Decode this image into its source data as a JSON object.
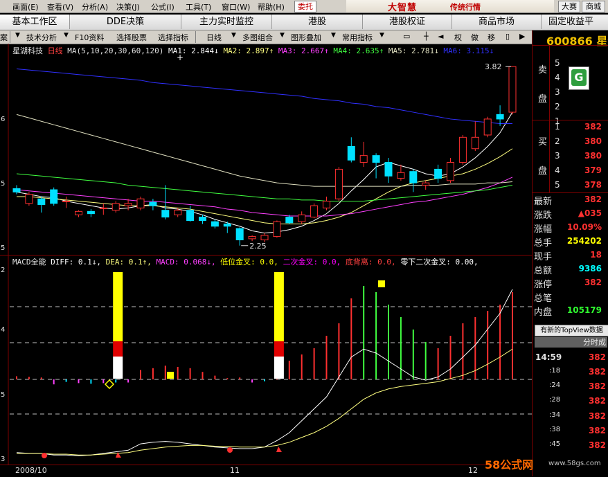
{
  "menu": {
    "items": [
      "画面(E)",
      "查看(V)",
      "分析(A)",
      "决策(J)",
      "公式(I)",
      "工具(T)",
      "窗口(W)",
      "帮助(H)"
    ],
    "weituo": "委托",
    "brand_logo": "大智慧",
    "brand_sub": "传统行情",
    "right_btn1": "大赛",
    "right_btn2": "商城"
  },
  "tabs": [
    "基本工作区",
    "DDE决策",
    "主力实时监控",
    "港股",
    "港股权证",
    "商品市场",
    "固定收益平"
  ],
  "toolbar": {
    "items": [
      "案",
      "技术分析",
      "F10资料",
      "选择股票",
      "选择指标",
      "日线",
      "多图组合",
      "图形叠加",
      "常用指标"
    ],
    "right": [
      "权",
      "做",
      "移"
    ]
  },
  "stock": {
    "code": "600866",
    "name_partial": "星湖",
    "title": "星湖科技",
    "period": "日线"
  },
  "ma_legend": {
    "param": "MA(5,10,20,30,60,120)",
    "ma1": "MA1: 2.844↓",
    "ma2": "MA2: 2.897↑",
    "ma3": "MA3: 2.667↑",
    "ma4": "MA4: 2.635↑",
    "ma5": "MA5: 2.781↓",
    "ma6": "MA6: 3.115↓"
  },
  "macd_legend": {
    "name": "MACD全能",
    "diff": "DIFF: 0.1↓,",
    "dea": "DEA: 0.1↑,",
    "macd": "MACD: 0.068↓,",
    "low_cross": "低位金叉: 0.0,",
    "second_cross": "二次金叉: 0.0,",
    "divergence": "底背离: 0.0,",
    "zero_cross": "零下二次金叉: 0.00,"
  },
  "chart_labels": {
    "high_label": "3.82",
    "low_label": "2.25",
    "left_axis_main": [
      "",
      "6",
      "5",
      "5"
    ],
    "left_axis_macd": [
      "2",
      "4",
      "5",
      "3"
    ],
    "x_labels": [
      "2008/10",
      "11",
      "12"
    ]
  },
  "order_book": {
    "sell_label_1": "卖",
    "sell_label_2": "盘",
    "sell_levels": [
      "5",
      "4",
      "3",
      "2",
      "1"
    ],
    "buy_label_1": "买",
    "buy_label_2": "盘",
    "buy_levels": [
      "1",
      "2",
      "3",
      "4",
      "5"
    ],
    "buy_prices": [
      "382",
      "380",
      "380",
      "379",
      "378"
    ]
  },
  "quote": {
    "rows": [
      {
        "label": "最新",
        "value": "382"
      },
      {
        "label": "涨跌",
        "value": "▲035"
      },
      {
        "label": "涨幅",
        "value": "10.09%"
      },
      {
        "label": "总手",
        "value": "254202"
      },
      {
        "label": "现手",
        "value": "18"
      },
      {
        "label": "总额",
        "value": "9386"
      },
      {
        "label": "涨停",
        "value": "382"
      },
      {
        "label": "总笔",
        "value": ""
      },
      {
        "label": "内盘",
        "value": "105179"
      }
    ]
  },
  "topview": "有新的TopView数据",
  "fenshi": "分时成",
  "ticks": [
    {
      "time": "14:59",
      "price": "382"
    },
    {
      "time": ":18",
      "price": "382"
    },
    {
      "time": ":24",
      "price": "382"
    },
    {
      "time": ":28",
      "price": "382"
    },
    {
      "time": ":34",
      "price": "382"
    },
    {
      "time": ":38",
      "price": "382"
    },
    {
      "time": ":45",
      "price": "382"
    }
  ],
  "watermark": "58公式网",
  "watermark_url": "www.58gs.com",
  "chart_data": {
    "type": "candlestick",
    "title": "星湖科技 日线",
    "candles": [
      {
        "o": 2.75,
        "c": 2.72,
        "h": 2.78,
        "l": 2.7
      },
      {
        "o": 2.62,
        "c": 2.7,
        "h": 2.72,
        "l": 2.6
      },
      {
        "o": 2.66,
        "c": 2.61,
        "h": 2.68,
        "l": 2.54
      },
      {
        "o": 2.74,
        "c": 2.62,
        "h": 2.76,
        "l": 2.6
      },
      {
        "o": 2.64,
        "c": 2.64,
        "h": 2.68,
        "l": 2.58
      },
      {
        "o": 2.52,
        "c": 2.55,
        "h": 2.56,
        "l": 2.5
      },
      {
        "o": 2.55,
        "c": 2.53,
        "h": 2.57,
        "l": 2.5
      },
      {
        "o": 2.58,
        "c": 2.58,
        "h": 2.62,
        "l": 2.52
      },
      {
        "o": 2.56,
        "c": 2.62,
        "h": 2.64,
        "l": 2.54
      },
      {
        "o": 2.6,
        "c": 2.62,
        "h": 2.66,
        "l": 2.56
      },
      {
        "o": 2.58,
        "c": 2.66,
        "h": 2.68,
        "l": 2.56
      },
      {
        "o": 2.63,
        "c": 2.6,
        "h": 2.66,
        "l": 2.56
      },
      {
        "o": 2.56,
        "c": 2.5,
        "h": 2.78,
        "l": 2.48
      },
      {
        "o": 2.52,
        "c": 2.56,
        "h": 2.58,
        "l": 2.5
      },
      {
        "o": 2.56,
        "c": 2.47,
        "h": 2.6,
        "l": 2.46
      },
      {
        "o": 2.5,
        "c": 2.47,
        "h": 2.52,
        "l": 2.44
      },
      {
        "o": 2.46,
        "c": 2.42,
        "h": 2.48,
        "l": 2.4
      },
      {
        "o": 2.44,
        "c": 2.42,
        "h": 2.46,
        "l": 2.36
      },
      {
        "o": 2.4,
        "c": 2.3,
        "h": 2.41,
        "l": 2.25
      },
      {
        "o": 2.31,
        "c": 2.33,
        "h": 2.34,
        "l": 2.29
      },
      {
        "o": 2.3,
        "c": 2.34,
        "h": 2.36,
        "l": 2.28
      },
      {
        "o": 2.33,
        "c": 2.46,
        "h": 2.47,
        "l": 2.32
      },
      {
        "o": 2.5,
        "c": 2.45,
        "h": 2.52,
        "l": 2.44
      },
      {
        "o": 2.46,
        "c": 2.52,
        "h": 2.55,
        "l": 2.44
      },
      {
        "o": 2.5,
        "c": 2.6,
        "h": 2.62,
        "l": 2.49
      },
      {
        "o": 2.58,
        "c": 2.64,
        "h": 2.68,
        "l": 2.56
      },
      {
        "o": 2.66,
        "c": 2.92,
        "h": 2.94,
        "l": 2.64
      },
      {
        "o": 3.12,
        "c": 3.0,
        "h": 3.2,
        "l": 2.98
      },
      {
        "o": 2.98,
        "c": 3.04,
        "h": 3.16,
        "l": 2.94
      },
      {
        "o": 3.04,
        "c": 2.98,
        "h": 3.06,
        "l": 2.84
      },
      {
        "o": 2.98,
        "c": 2.86,
        "h": 3.02,
        "l": 2.8
      },
      {
        "o": 2.84,
        "c": 2.89,
        "h": 2.96,
        "l": 2.82
      },
      {
        "o": 2.9,
        "c": 2.8,
        "h": 2.92,
        "l": 2.72
      },
      {
        "o": 2.78,
        "c": 2.8,
        "h": 2.82,
        "l": 2.74
      },
      {
        "o": 2.92,
        "c": 2.84,
        "h": 2.96,
        "l": 2.8
      },
      {
        "o": 2.82,
        "c": 2.98,
        "h": 3.02,
        "l": 2.8
      },
      {
        "o": 2.98,
        "c": 3.2,
        "h": 3.22,
        "l": 2.96
      },
      {
        "o": 3.1,
        "c": 3.2,
        "h": 3.34,
        "l": 3.08
      },
      {
        "o": 3.22,
        "c": 3.36,
        "h": 3.38,
        "l": 3.2
      },
      {
        "o": 3.4,
        "c": 3.36,
        "h": 3.48,
        "l": 3.3
      },
      {
        "o": 3.42,
        "c": 3.82,
        "h": 3.82,
        "l": 3.4
      }
    ],
    "ylim": [
      2.2,
      3.9
    ],
    "ma": [
      {
        "name": "MA1",
        "color": "#ffffff",
        "values": [
          2.72,
          2.7,
          2.68,
          2.67,
          2.64,
          2.62,
          2.6,
          2.58,
          2.57,
          2.58,
          2.6,
          2.61,
          2.58,
          2.57,
          2.55,
          2.52,
          2.48,
          2.45,
          2.42,
          2.38,
          2.36,
          2.37,
          2.39,
          2.42,
          2.47,
          2.53,
          2.62,
          2.73,
          2.83,
          2.94,
          2.98,
          2.95,
          2.92,
          2.88,
          2.86,
          2.88,
          2.94,
          3.02,
          3.12,
          3.24,
          3.42
        ]
      },
      {
        "name": "MA2",
        "color": "#ffff80",
        "values": [
          2.68,
          2.68,
          2.67,
          2.66,
          2.65,
          2.64,
          2.63,
          2.62,
          2.61,
          2.6,
          2.6,
          2.6,
          2.59,
          2.58,
          2.57,
          2.55,
          2.53,
          2.51,
          2.49,
          2.47,
          2.45,
          2.44,
          2.44,
          2.44,
          2.45,
          2.47,
          2.5,
          2.54,
          2.6,
          2.66,
          2.72,
          2.77,
          2.8,
          2.82,
          2.84,
          2.86,
          2.88,
          2.92,
          2.97,
          3.03,
          3.1
        ]
      },
      {
        "name": "MA3",
        "color": "#ff40ff",
        "values": [
          2.74,
          2.73,
          2.72,
          2.71,
          2.7,
          2.69,
          2.68,
          2.67,
          2.66,
          2.65,
          2.64,
          2.64,
          2.63,
          2.62,
          2.61,
          2.6,
          2.59,
          2.57,
          2.56,
          2.54,
          2.53,
          2.52,
          2.51,
          2.51,
          2.51,
          2.51,
          2.52,
          2.53,
          2.55,
          2.57,
          2.59,
          2.61,
          2.63,
          2.64,
          2.66,
          2.68,
          2.7,
          2.73,
          2.76,
          2.8,
          2.85
        ]
      },
      {
        "name": "MA4",
        "color": "#40ff40",
        "values": [
          2.88,
          2.87,
          2.86,
          2.85,
          2.84,
          2.83,
          2.82,
          2.81,
          2.8,
          2.78,
          2.77,
          2.76,
          2.75,
          2.74,
          2.73,
          2.72,
          2.71,
          2.7,
          2.69,
          2.68,
          2.67,
          2.66,
          2.66,
          2.65,
          2.65,
          2.64,
          2.64,
          2.64,
          2.64,
          2.65,
          2.66,
          2.67,
          2.68,
          2.69,
          2.7,
          2.71,
          2.72,
          2.73,
          2.74,
          2.76,
          2.78
        ]
      },
      {
        "name": "MA5",
        "color": "#e0e0c0",
        "values": [
          3.4,
          3.37,
          3.34,
          3.31,
          3.28,
          3.25,
          3.22,
          3.19,
          3.16,
          3.13,
          3.1,
          3.07,
          3.04,
          3.01,
          2.98,
          2.95,
          2.92,
          2.89,
          2.86,
          2.84,
          2.82,
          2.8,
          2.79,
          2.78,
          2.77,
          2.77,
          2.77,
          2.77,
          2.77,
          2.77,
          2.77,
          2.77,
          2.78,
          2.78,
          2.78,
          2.79,
          2.79,
          2.79,
          2.8,
          2.8,
          2.81
        ]
      },
      {
        "name": "MA6",
        "color": "#3030ff",
        "values": [
          3.8,
          3.79,
          3.78,
          3.77,
          3.76,
          3.75,
          3.74,
          3.73,
          3.72,
          3.71,
          3.7,
          3.68,
          3.67,
          3.66,
          3.65,
          3.64,
          3.63,
          3.62,
          3.61,
          3.6,
          3.59,
          3.58,
          3.57,
          3.56,
          3.54,
          3.53,
          3.52,
          3.5,
          3.49,
          3.47,
          3.46,
          3.44,
          3.42,
          3.4,
          3.38,
          3.36,
          3.35,
          3.34,
          3.33,
          3.32,
          3.32
        ]
      }
    ],
    "macd_bars": [
      0.005,
      0.004,
      0.003,
      -0.008,
      -0.004,
      -0.006,
      -0.007,
      -0.006,
      -0.005,
      -0.005,
      0.015,
      0.018,
      0.022,
      0.02,
      0.018,
      0.012,
      0.006,
      0.002,
      0.003,
      -0.005,
      -0.003,
      0.02,
      0.03,
      0.04,
      0.05,
      0.07,
      0.09,
      0.13,
      0.15,
      0.14,
      0.12,
      0.1,
      0.08,
      0.06,
      0.05,
      0.07,
      0.09,
      0.1,
      0.11,
      0.12,
      0.14
    ],
    "diff": [
      -0.005,
      -0.006,
      -0.006,
      -0.008,
      -0.008,
      -0.009,
      -0.008,
      -0.006,
      -0.004,
      -0.002,
      0.006,
      0.008,
      0.009,
      0.008,
      0.006,
      0.004,
      0.002,
      0.001,
      0.0,
      0.0,
      0.002,
      0.01,
      0.02,
      0.035,
      0.05,
      0.065,
      0.09,
      0.115,
      0.125,
      0.12,
      0.11,
      0.1,
      0.09,
      0.086,
      0.09,
      0.1,
      0.115,
      0.13,
      0.15,
      0.17,
      0.2
    ],
    "dea": [
      -0.006,
      -0.006,
      -0.006,
      -0.007,
      -0.007,
      -0.008,
      -0.008,
      -0.007,
      -0.006,
      -0.005,
      -0.002,
      0.0,
      0.002,
      0.003,
      0.004,
      0.004,
      0.003,
      0.003,
      0.002,
      0.002,
      0.002,
      0.004,
      0.008,
      0.014,
      0.02,
      0.028,
      0.038,
      0.05,
      0.062,
      0.07,
      0.075,
      0.078,
      0.08,
      0.082,
      0.084,
      0.088,
      0.092,
      0.098,
      0.106,
      0.115,
      0.125
    ]
  }
}
